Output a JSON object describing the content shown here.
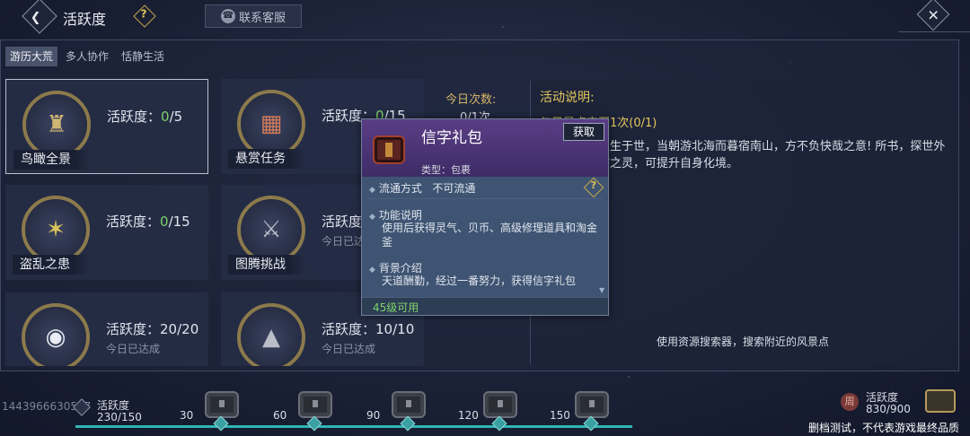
{
  "header": {
    "title": "活跃度",
    "help_icon": "question-diamond-icon",
    "contact_button": "联系客服",
    "back_icon": "chevron-left-icon",
    "close_icon": "close-icon"
  },
  "tabs": [
    {
      "label": "游历大荒",
      "active": true
    },
    {
      "label": "多人协作",
      "active": false
    },
    {
      "label": "恬静生活",
      "active": false
    }
  ],
  "activity_prefix": "活跃度：",
  "cards": [
    {
      "name": "鸟瞰全景",
      "current": "0",
      "max": "/5",
      "sub": "",
      "icon": "pagoda-icon"
    },
    {
      "name": "悬赏任务",
      "current": "0",
      "max": "/15",
      "sub": "",
      "icon": "bounty-board-icon"
    },
    {
      "name": "盗乱之患",
      "current": "0",
      "max": "/15",
      "sub": "",
      "icon": "bandit-icon"
    },
    {
      "name": "图腾挑战",
      "current": "",
      "max": "",
      "sub": "今日已达成",
      "icon": "crossed-axes-icon"
    },
    {
      "name": "",
      "current": "20",
      "max": "/20",
      "sub": "今日已达成",
      "icon": "coin-icon"
    },
    {
      "name": "",
      "current": "10",
      "max": "/10",
      "sub": "今日已达成",
      "icon": "beast-icon"
    }
  ],
  "detail": {
    "today_label": "今日次数:",
    "today_value": "0/1次",
    "desc_title": "活动说明:",
    "desc_task": "与风景点交互1次(0/1)",
    "desc_text": "乃穷尽也。人生于世，当朝游北海而暮宿南山，方不负快哉之意! 所书，探世外之境，感亘古之灵，可提升自身化境。",
    "hint": "使用资源搜索器，搜索附近的风景点"
  },
  "popup": {
    "title": "信字礼包",
    "get_button": "获取",
    "type": "类型：包裹",
    "circulation_label": "流通方式",
    "circulation_value": "不可流通",
    "function_label": "功能说明",
    "function_text": "使用后获得灵气、贝币、高级修理道具和淘金釜",
    "background_label": "背景介绍",
    "background_text": "天道酬勤，经过一番努力，获得信字礼包",
    "level": "45级可用"
  },
  "bottom": {
    "uid": "1443966630527",
    "activity_label": "活跃度",
    "activity_value": "230/150",
    "milestones": [
      "30",
      "60",
      "90",
      "120",
      "150"
    ],
    "progress": 1.0,
    "right_icon_text": "周",
    "right_label": "活跃度",
    "right_value": "830/900",
    "disclaimer": "删档测试，不代表游戏最终品质"
  }
}
